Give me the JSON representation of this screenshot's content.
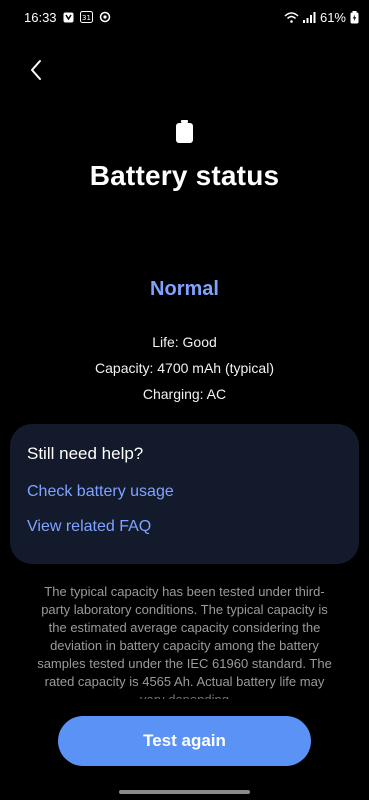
{
  "status_bar": {
    "time": "16:33",
    "battery_percent": "61%",
    "icons": [
      "notification-icon",
      "calendar-icon",
      "sync-icon",
      "wifi-icon",
      "signal-icon",
      "battery-charging-icon"
    ],
    "calendar_day": "31"
  },
  "header": {
    "back_icon": "back-arrow-icon",
    "battery_icon": "battery-icon",
    "title": "Battery status"
  },
  "status": {
    "value": "Normal",
    "color": "#7fa3ff"
  },
  "details": {
    "life": "Life: Good",
    "capacity": "Capacity: 4700 mAh (typical)",
    "charging": "Charging: AC"
  },
  "help": {
    "title": "Still need help?",
    "links": [
      "Check battery usage",
      "View related FAQ"
    ]
  },
  "disclaimer": "The typical capacity has been tested under third-party laboratory conditions. The typical capacity is the estimated average capacity considering the deviation in battery capacity among the battery samples tested under the IEC 61960 standard. The rated capacity is 4565 Ah. Actual battery life may vary depending",
  "action": {
    "label": "Test again",
    "color": "#5a93f5"
  }
}
